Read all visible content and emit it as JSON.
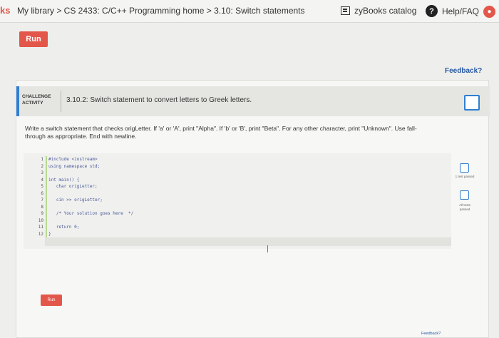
{
  "topbar": {
    "brand": "ks",
    "breadcrumb": "My library > CS 2433: C/C++ Programming home > 3.10: Switch statements",
    "catalog_label": "zyBooks catalog",
    "help_label": "Help/FAQ"
  },
  "toolbar": {
    "run_label": "Run",
    "feedback_label": "Feedback?"
  },
  "challenge": {
    "tag": "CHALLENGE ACTIVITY",
    "title": "3.10.2: Switch statement to convert letters to Greek letters.",
    "instructions": "Write a switch statement that checks origLetter. If 'a' or 'A', print \"Alpha\". If 'b' or 'B', print \"Beta\". For any other character, print \"Unknown\". Use fall-through as appropriate. End with newline.",
    "line_numbers": [
      "1",
      "2",
      "3",
      "4",
      "5",
      "6",
      "7",
      "8",
      "9",
      "10",
      "11",
      "12"
    ],
    "code_lines": [
      "#include <iostream>",
      "using namespace std;",
      "",
      "int main() {",
      "   char origLetter;",
      "",
      "   cin >> origLetter;",
      "",
      "   /* Your solution goes here  */",
      "",
      "   return 0;",
      "}"
    ],
    "run_label": "Run",
    "tests": [
      {
        "label": "1 test passed"
      },
      {
        "label": "All tests passed"
      }
    ],
    "feedback_label": "Feedback?"
  },
  "colors": {
    "accent": "#e3574b",
    "link": "#2455a4",
    "status_blue": "#2f7fd1"
  }
}
